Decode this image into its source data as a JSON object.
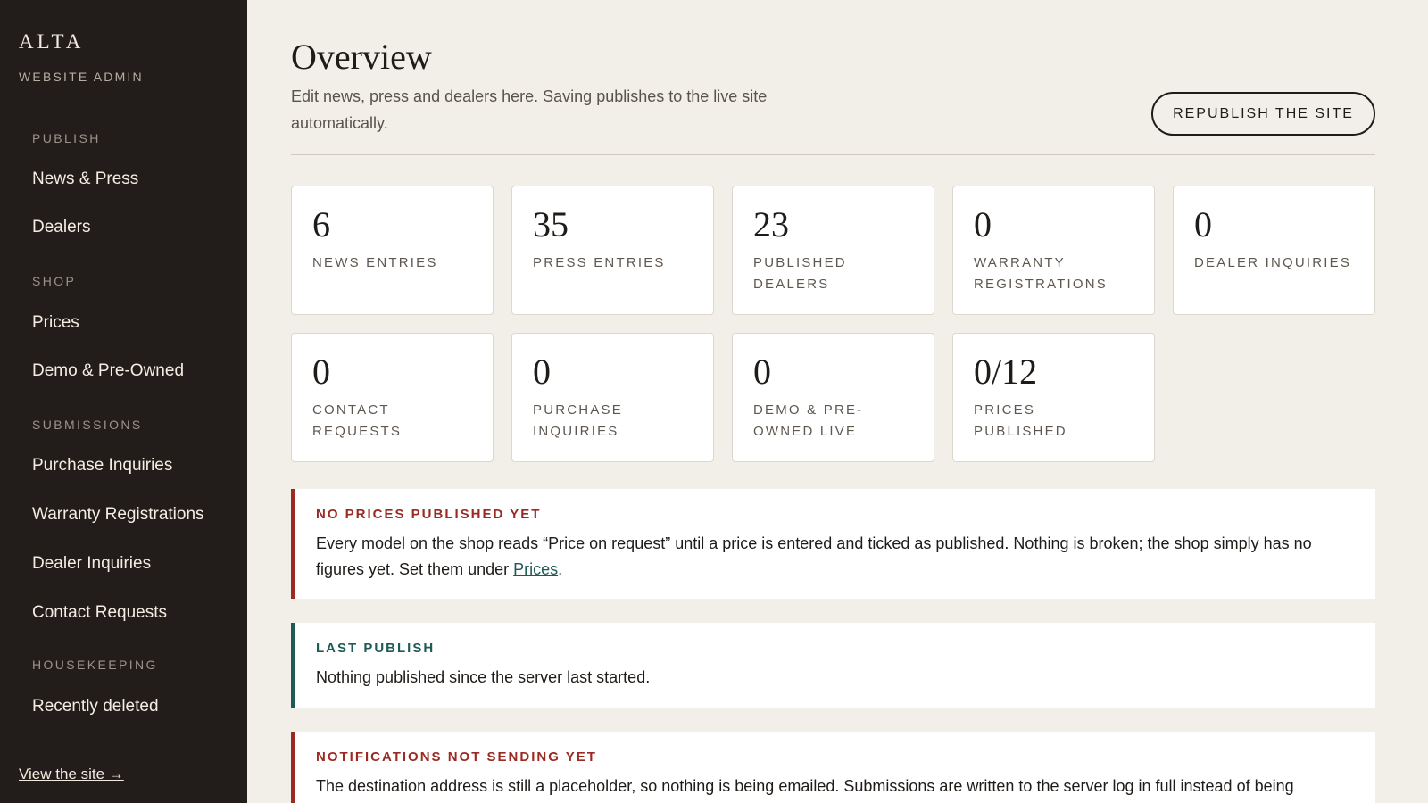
{
  "sidebar": {
    "brand": "ALTA",
    "subtitle": "WEBSITE ADMIN",
    "sections": {
      "publish": "PUBLISH",
      "shop": "SHOP",
      "submissions": "SUBMISSIONS",
      "housekeeping": "HOUSEKEEPING"
    },
    "items": {
      "news_press": "News & Press",
      "dealers": "Dealers",
      "prices": "Prices",
      "demo_preowned": "Demo & Pre-Owned",
      "purchase_inquiries": "Purchase Inquiries",
      "warranty_registrations": "Warranty Registrations",
      "dealer_inquiries": "Dealer Inquiries",
      "contact_requests": "Contact Requests",
      "recently_deleted": "Recently deleted"
    },
    "view_site": "View the site →"
  },
  "header": {
    "title": "Overview",
    "description": "Edit news, press and dealers here. Saving publishes to the live site automatically.",
    "republish_label": "REPUBLISH THE SITE"
  },
  "stats": [
    {
      "value": "6",
      "label": "NEWS ENTRIES"
    },
    {
      "value": "35",
      "label": "PRESS ENTRIES"
    },
    {
      "value": "23",
      "label": "PUBLISHED DEALERS"
    },
    {
      "value": "0",
      "label": "WARRANTY REGISTRATIONS"
    },
    {
      "value": "0",
      "label": "DEALER INQUIRIES"
    },
    {
      "value": "0",
      "label": "CONTACT REQUESTS"
    },
    {
      "value": "0",
      "label": "PURCHASE INQUIRIES"
    },
    {
      "value": "0",
      "label": "DEMO & PRE-OWNED LIVE"
    },
    {
      "value": "0/12",
      "label": "PRICES PUBLISHED"
    }
  ],
  "notices": {
    "prices": {
      "title": "NO PRICES PUBLISHED YET",
      "body": "Every model on the shop reads “Price on request” until a price is entered and ticked as published. Nothing is broken; the shop simply has no figures yet. Set them under ",
      "link": "Prices",
      "suffix": "."
    },
    "last_publish": {
      "title": "LAST PUBLISH",
      "body": "Nothing published since the server last started."
    },
    "notifications": {
      "title": "NOTIFICATIONS NOT SENDING YET",
      "body": "The destination address is still a placeholder, so nothing is being emailed. Submissions are written to the server log in full instead of being"
    }
  },
  "colors": {
    "sidebar_bg": "#221d1a",
    "page_bg": "#f2efe8",
    "warning_accent": "#9a2a22",
    "info_accent": "#1f5a55"
  }
}
